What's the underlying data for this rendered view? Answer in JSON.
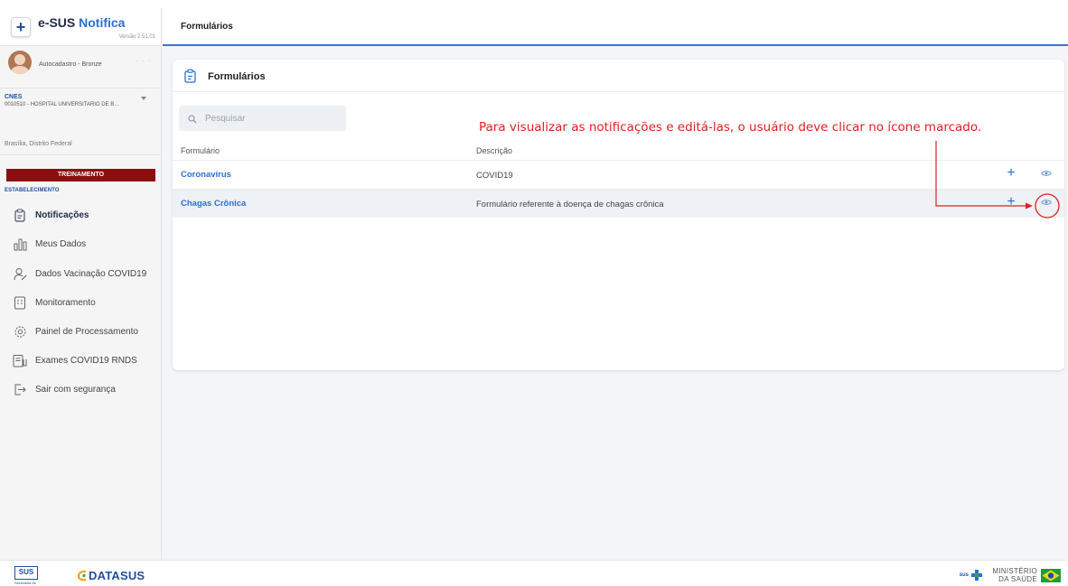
{
  "app": {
    "name_prefix": "e-SUS ",
    "name_accent": "Notifica",
    "version": "Versão 2.51.01"
  },
  "user": {
    "role": "Autocadastro - Bronze",
    "dots": "· · ·"
  },
  "cnes": {
    "label": "CNES",
    "value": "0010510 - HOSPITAL UNIVERSITARIO DE B...",
    "city": "Brasília, Distrito Federal"
  },
  "environment": "TREINAMENTO",
  "section_label": "ESTABELECIMENTO",
  "nav": [
    {
      "label": "Notificações",
      "icon": "clipboard-icon"
    },
    {
      "label": "Meus Dados",
      "icon": "bar-chart-icon"
    },
    {
      "label": "Dados Vacinação COVID19",
      "icon": "user-syringe-icon"
    },
    {
      "label": "Monitoramento",
      "icon": "monitor-list-icon"
    },
    {
      "label": "Painel de Processamento",
      "icon": "gear-icon"
    },
    {
      "label": "Exames COVID19 RNDS",
      "icon": "lab-clipboard-icon"
    },
    {
      "label": "Sair com segurança",
      "icon": "logout-icon"
    }
  ],
  "header": {
    "title": "Formulários"
  },
  "card": {
    "title": "Formulários",
    "search_placeholder": "Pesquisar",
    "columns": [
      "Formulário",
      "Descrição"
    ],
    "rows": [
      {
        "form": "Coronavírus",
        "description": "COVID19"
      },
      {
        "form": "Chagas Crônica",
        "description": "Formulário referente à doença de chagas crônica"
      }
    ]
  },
  "annotation": "Para visualizar as notificações e editá-las, o usuário deve clicar no ícone marcado.",
  "footer": {
    "sus_logo": "SUS",
    "sus_sub": "Secretaria de",
    "datasus": "DATASUS",
    "ministry_sus": "sus",
    "ministry": "MINISTÉRIO DA SAÚDE"
  },
  "colors": {
    "accent": "#2d6ed6",
    "environment_badge": "#8b0f0f",
    "annotation": "#e02020"
  }
}
